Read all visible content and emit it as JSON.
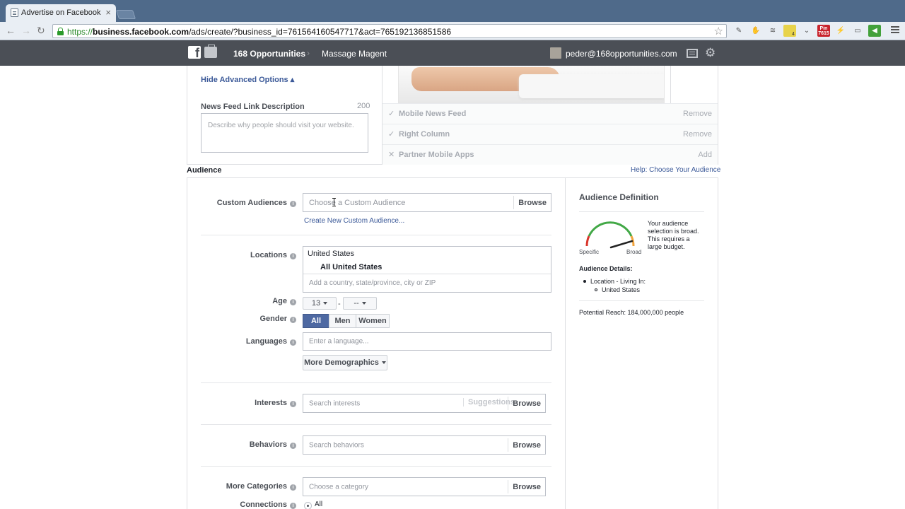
{
  "browser": {
    "tab_title": "Advertise on Facebook",
    "tab_close": "×",
    "url_scheme": "https://",
    "url_host": "business.facebook.com",
    "url_path": "/ads/create/?business_id=761564160547717&act=765192136851586",
    "ext_pin_badge": "Pin",
    "ext_pin_count": "7615",
    "ext_note_count": "4"
  },
  "fb_header": {
    "account": "168 Opportunities",
    "campaign": "Massage Magent",
    "email": "peder@168opportunities.com"
  },
  "creative": {
    "hide_advanced": "Hide Advanced Options ▴",
    "nf_label": "News Feed Link Description",
    "nf_count": "200",
    "nf_placeholder": "Describe why people should visit your website."
  },
  "placements": [
    {
      "mark": "✓",
      "label": "Mobile News Feed",
      "action": "Remove"
    },
    {
      "mark": "✓",
      "label": "Right Column",
      "action": "Remove"
    },
    {
      "mark": "✕",
      "label": "Partner Mobile Apps",
      "action": "Add"
    }
  ],
  "audience": {
    "title": "Audience",
    "help": "Help: Choose Your Audience",
    "custom_label": "Custom Audiences",
    "custom_placeholder": "Choose a Custom Audience",
    "browse": "Browse",
    "create_custom": "Create New Custom Audience...",
    "locations_label": "Locations",
    "location_country": "United States",
    "location_all": "All United States",
    "location_placeholder": "Add a country, state/province, city or ZIP",
    "age_label": "Age",
    "age_min": "13",
    "age_max": "--",
    "age_dash": "-",
    "gender_label": "Gender",
    "gender_options": [
      "All",
      "Men",
      "Women"
    ],
    "languages_label": "Languages",
    "languages_placeholder": "Enter a language...",
    "more_demographics": "More Demographics",
    "interests_label": "Interests",
    "interests_placeholder": "Search interests",
    "suggestions": "Suggestions",
    "behaviors_label": "Behaviors",
    "behaviors_placeholder": "Search behaviors",
    "more_categories_label": "More Categories",
    "categories_placeholder": "Choose a category",
    "connections_label": "Connections",
    "connections_all": "All"
  },
  "definition": {
    "title": "Audience Definition",
    "gauge_specific": "Specific",
    "gauge_broad": "Broad",
    "gauge_text": "Your audience selection is broad. This requires a large budget.",
    "gauge_level": "broad",
    "details_title": "Audience Details:",
    "detail_location": "Location - Living In:",
    "detail_country": "United States",
    "reach": "Potential Reach: 184,000,000 people"
  },
  "colors": {
    "fb_blue": "#3b5998",
    "header_bg": "#4b4f56",
    "active_segment": "#4e69a2",
    "gauge_red": "#d9352b",
    "gauge_green": "#42a846",
    "gauge_orange": "#f0a23b"
  }
}
